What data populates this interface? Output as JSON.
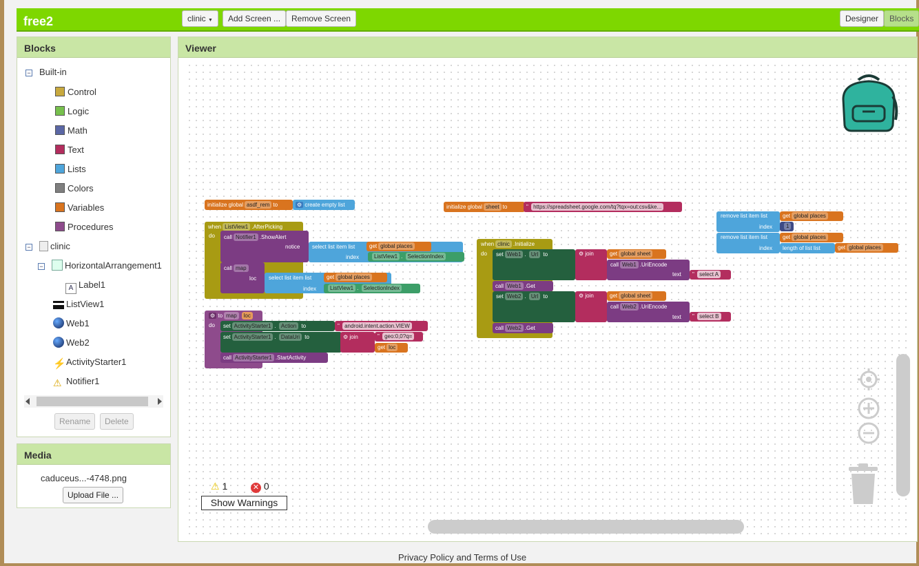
{
  "app": {
    "title": "free2"
  },
  "toolbar": {
    "screen": "clinic",
    "add_screen": "Add Screen ...",
    "remove_screen": "Remove Screen",
    "designer": "Designer",
    "blocks": "Blocks"
  },
  "blocks_panel": {
    "title": "Blocks",
    "builtin_label": "Built-in",
    "builtin": [
      {
        "label": "Control",
        "color": "#c8a93e"
      },
      {
        "label": "Logic",
        "color": "#77c04d"
      },
      {
        "label": "Math",
        "color": "#5b67a5"
      },
      {
        "label": "Text",
        "color": "#b32d5e"
      },
      {
        "label": "Lists",
        "color": "#4ea5db"
      },
      {
        "label": "Colors",
        "color": "#7f7f7f"
      },
      {
        "label": "Variables",
        "color": "#d9741f"
      },
      {
        "label": "Procedures",
        "color": "#8e4b8c"
      }
    ],
    "screen": "clinic",
    "components": [
      "HorizontalArrangement1",
      "Label1",
      "ListView1",
      "Web1",
      "Web2",
      "ActivityStarter1",
      "Notifier1"
    ],
    "rename": "Rename",
    "delete": "Delete"
  },
  "media": {
    "title": "Media",
    "file": "caduceus...-4748.png",
    "upload": "Upload File ..."
  },
  "viewer": {
    "title": "Viewer"
  },
  "warnings": {
    "warn_count": "1",
    "error_count": "0",
    "button": "Show Warnings"
  },
  "footer": {
    "text": "Privacy Policy and Terms of Use"
  },
  "blocks": {
    "init1": {
      "lbl": "initialize global",
      "name": "asdf_rem",
      "to": "to",
      "val": "create empty list"
    },
    "init2": {
      "lbl": "initialize global",
      "name": "sheet",
      "to": "to",
      "val": "https://spreadsheet.google.com/tq?tqx=out:csv&ke..."
    },
    "evt1": {
      "when": "when",
      "comp": "ListView1",
      "evt": ".AfterPicking",
      "do": "do",
      "call": "call",
      "notifier": "Notifier1",
      "show": ".ShowAlert",
      "notice": "notice",
      "sel": "select list item  list",
      "get": "get",
      "places": "global places",
      "index": "index",
      "lv": "ListView1",
      "selidx": "SelectionIndex",
      "call2": "call",
      "map": "map",
      "loc": "loc"
    },
    "proc": {
      "to": "to",
      "map": "map",
      "loc": "loc",
      "do": "do",
      "set": "set",
      "as": "ActivityStarter1",
      "action": "Action",
      "to2": "to",
      "intent": "android.intent.action.VIEW",
      "datauri": "DataUri",
      "join": "join",
      "geo": "geo:0,0?q=",
      "get": "get",
      "loc2": "loc",
      "call": "call",
      "start": ".StartActivity"
    },
    "evt2": {
      "when": "when",
      "comp": "clinic",
      "evt": ".Initialize",
      "do": "do",
      "set": "set",
      "web1": "Web1",
      "url": "Url",
      "to": "to",
      "join": "join",
      "get": "get",
      "sheet": "global sheet",
      "call": "call",
      "encode": ".UriEncode",
      "text": "text",
      "sela": "select A",
      "get_lbl": ".Get",
      "web2": "Web2",
      "selb": "select B"
    },
    "rem": {
      "lbl": "remove list item  list",
      "get": "get",
      "places": "global places",
      "index": "index",
      "one": "1",
      "len": "length of list  list"
    }
  }
}
